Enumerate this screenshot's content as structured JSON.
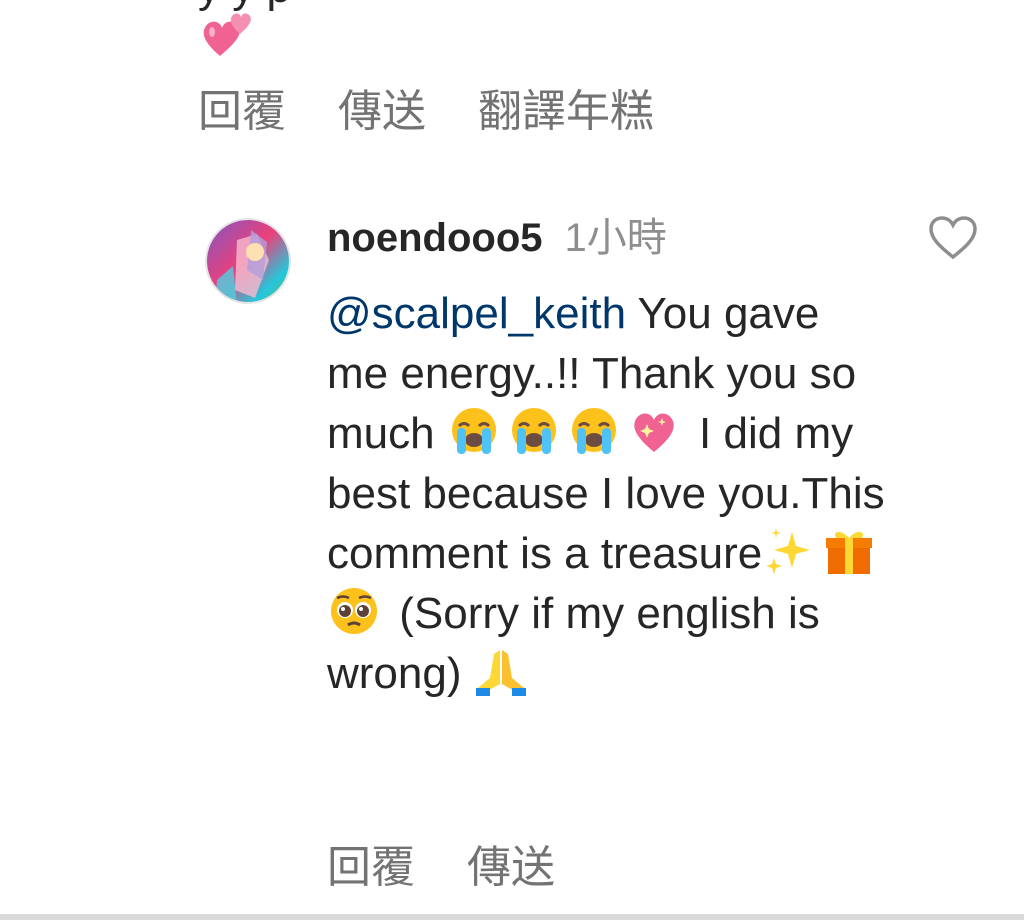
{
  "previous_comment": {
    "text_fragment": "y  y  p",
    "actions": [
      "回覆",
      "傳送",
      "翻譯年糕"
    ]
  },
  "comment": {
    "username": "noendooo5",
    "timestamp": "1小時",
    "mention": "@scalpel_keith",
    "text_part1": " You gave me energy..!! Thank you so much",
    "text_part2": " I did my best because I love you.This comment is a treasure",
    "text_part3": " (Sorry if my english is wrong)",
    "actions": [
      "回覆",
      "傳送"
    ],
    "emojis": [
      "loudly-crying-face",
      "loudly-crying-face",
      "loudly-crying-face",
      "sparkling-heart",
      "sparkles",
      "wrapped-gift",
      "pleading-face",
      "folded-hands"
    ]
  },
  "colors": {
    "text": "#262626",
    "secondary": "#737373",
    "timestamp": "#8e8e8e",
    "mention": "#00376b",
    "background": "#ffffff"
  }
}
